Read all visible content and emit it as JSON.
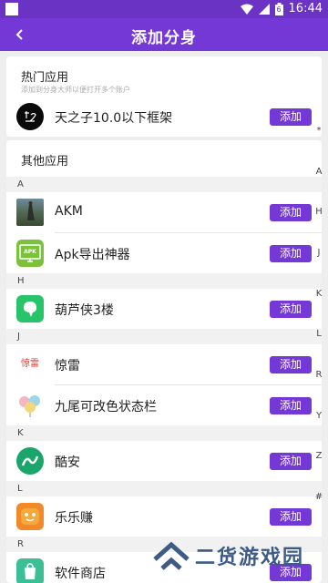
{
  "status": {
    "time": "16:44",
    "battery": "6"
  },
  "header": {
    "title": "添加分身"
  },
  "hot": {
    "heading": "热门应用",
    "subtitle": "添加到分身大师以便打开多个账户",
    "item": {
      "name": "天之子10.0以下框架",
      "button": "添加"
    }
  },
  "others": {
    "heading": "其他应用",
    "sections": [
      {
        "letter": "A",
        "items": [
          {
            "name": "AKM",
            "button": "添加"
          },
          {
            "name": "Apk导出神器",
            "button": "添加"
          }
        ]
      },
      {
        "letter": "H",
        "items": [
          {
            "name": "葫芦侠3楼",
            "button": "添加"
          }
        ]
      },
      {
        "letter": "J",
        "items": [
          {
            "name": "惊雷",
            "button": "添加"
          },
          {
            "name": "九尾可改色状态栏",
            "button": "添加"
          }
        ]
      },
      {
        "letter": "K",
        "items": [
          {
            "name": "酷安",
            "button": "添加"
          }
        ]
      },
      {
        "letter": "L",
        "items": [
          {
            "name": "乐乐赚",
            "button": "添加"
          }
        ]
      },
      {
        "letter": "R",
        "items": [
          {
            "name": "软件商店",
            "button": "添加"
          }
        ]
      }
    ]
  },
  "icon_labels": {
    "apk": "APK",
    "jinglei": "惊雷"
  },
  "index_bar": [
    "*",
    "A",
    "H",
    "J",
    "K",
    "L",
    "R",
    "Y",
    "Z",
    "#"
  ],
  "watermark": "二货游戏园",
  "colors": {
    "primary": "#7338d6",
    "statusbar": "#6a33c4"
  }
}
